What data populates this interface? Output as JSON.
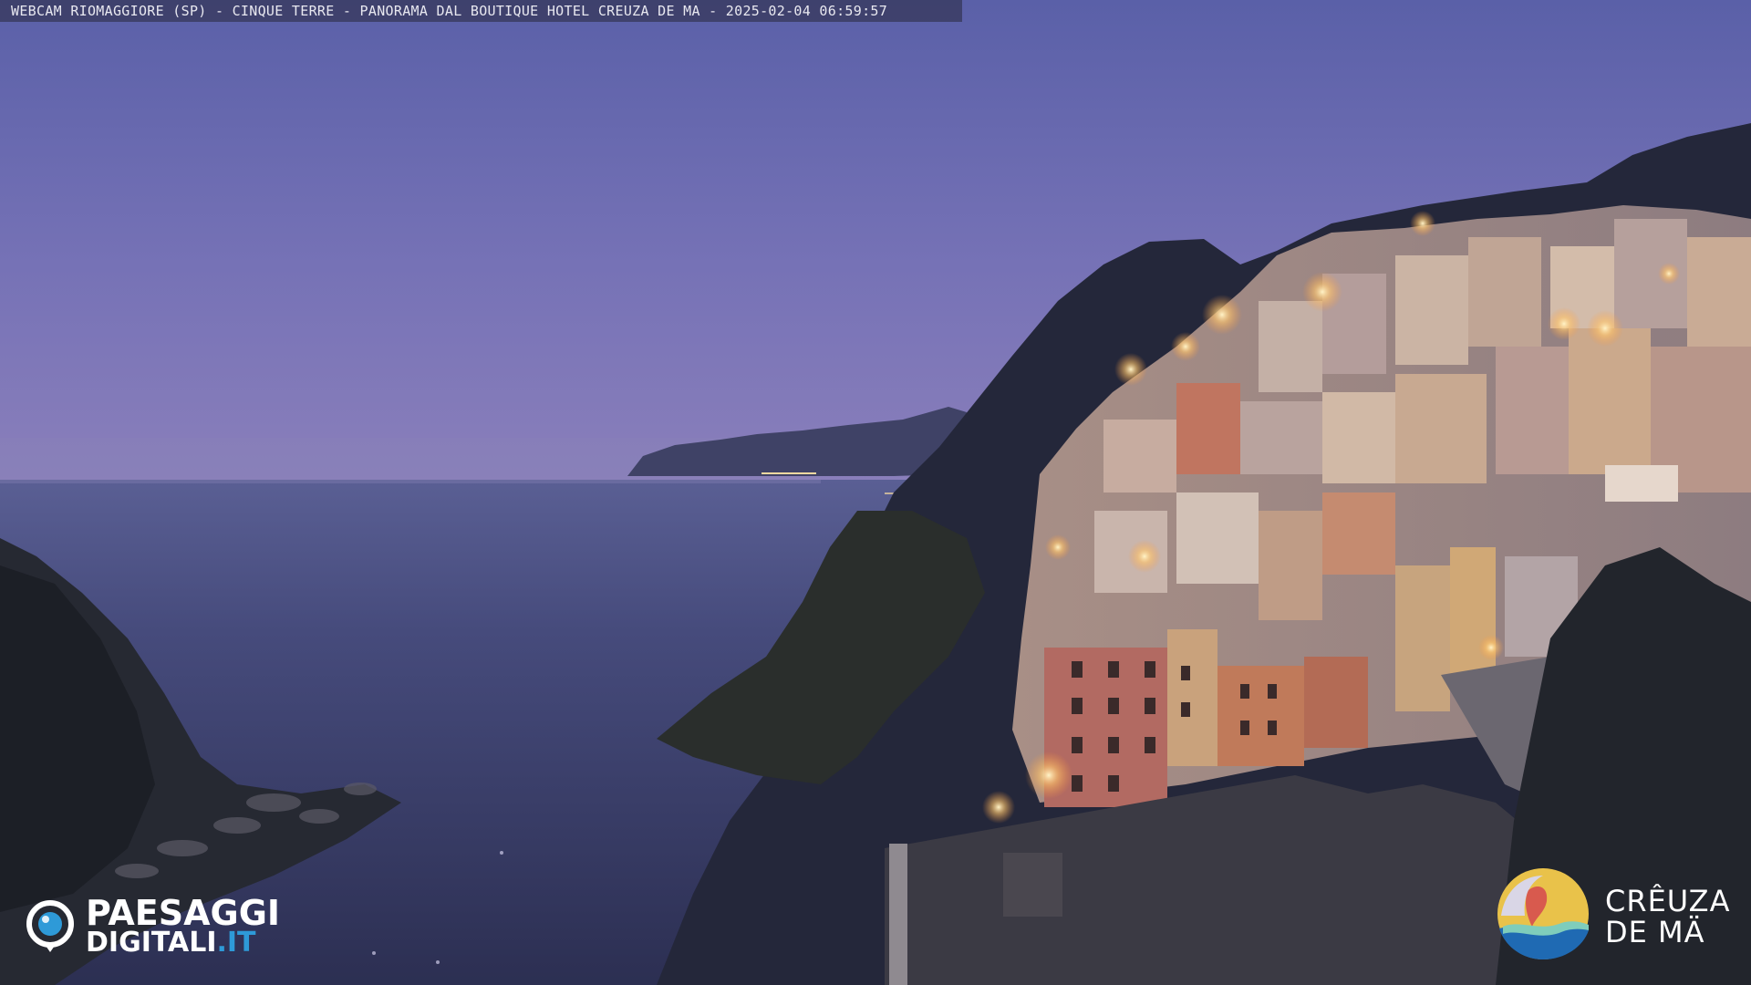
{
  "caption": {
    "text": "WEBCAM RIOMAGGIORE (SP) - CINQUE TERRE - PANORAMA DAL BOUTIQUE HOTEL CREUZA DE MA - 2025-02-04 06:59:57"
  },
  "logos": {
    "paesaggi_digitali": {
      "line1": "PAESAGGI",
      "line2_main": "DIGITALI",
      "line2_tld": ".IT",
      "accent": "#2e9ad8"
    },
    "creuza_de_ma": {
      "word1": "CRÊUZA",
      "word2": "DE MÄ"
    }
  },
  "scene": {
    "description_colors": {
      "sky_top": "#5d63a8",
      "sky_horizon": "#7c78b8",
      "sea": "#3a3e66",
      "cliff": "#1f2230",
      "town_light": "#f4c98a"
    }
  }
}
